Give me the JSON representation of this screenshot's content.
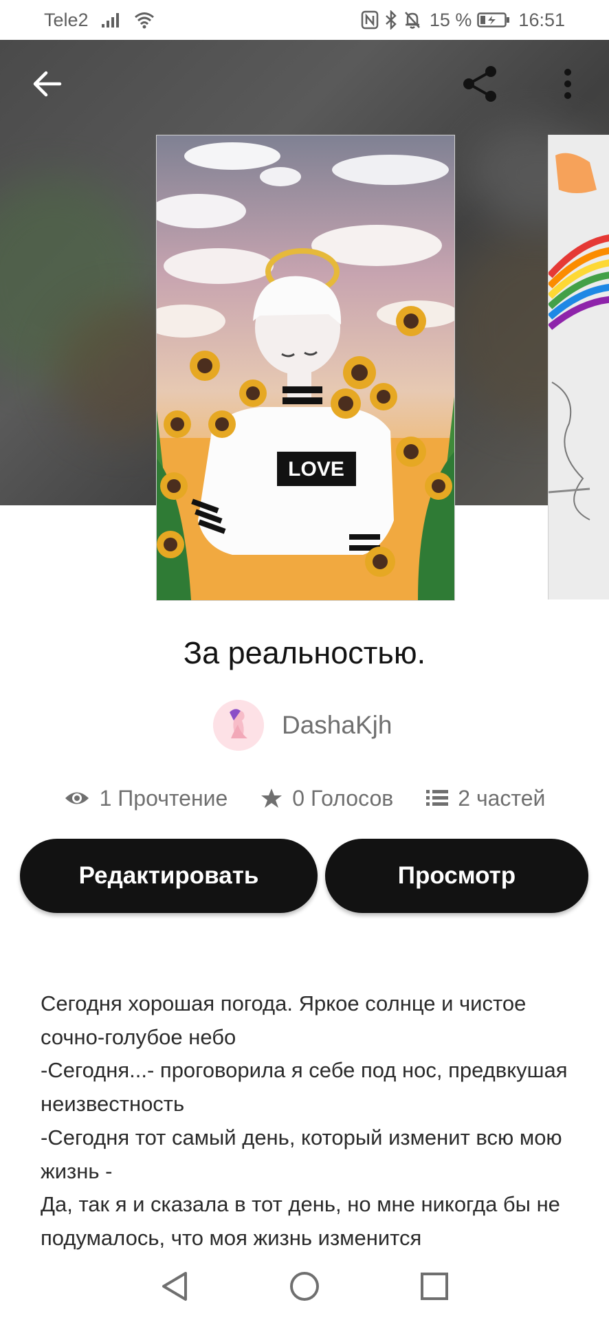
{
  "status_bar": {
    "carrier": "Tele2",
    "battery_percent": "15 %",
    "time": "16:51",
    "icons": [
      "signal-icon",
      "wifi-icon",
      "nfc-icon",
      "bluetooth-icon",
      "mute-icon",
      "battery-icon"
    ]
  },
  "toolbar": {
    "back_icon": "arrow-left-icon",
    "share_icon": "share-icon",
    "more_icon": "more-vertical-icon"
  },
  "story": {
    "title": "За реальностью.",
    "author": "DashaKjh",
    "cover_text": "LOVE",
    "stats": {
      "reads": "1 Прочтение",
      "votes": "0 Голосов",
      "parts": "2 частей"
    },
    "description": [
      "Сегодня хорошая погода. Яркое солнце и чистое сочно-голубое небо",
      "-Сегодня...- проговорила я себе под нос, предвкушая неизвестность",
      "-Сегодня тот самый день, который изменит всю мою жизнь -",
      "Да, так я и сказала в тот день, но мне никогда бы не подумалось, что моя жизнь изменится"
    ]
  },
  "actions": {
    "edit_label": "Редактировать",
    "view_label": "Просмотр"
  },
  "colors": {
    "button_bg": "#121212",
    "button_text": "#ffffff",
    "meta_text": "#6f6f6f"
  }
}
